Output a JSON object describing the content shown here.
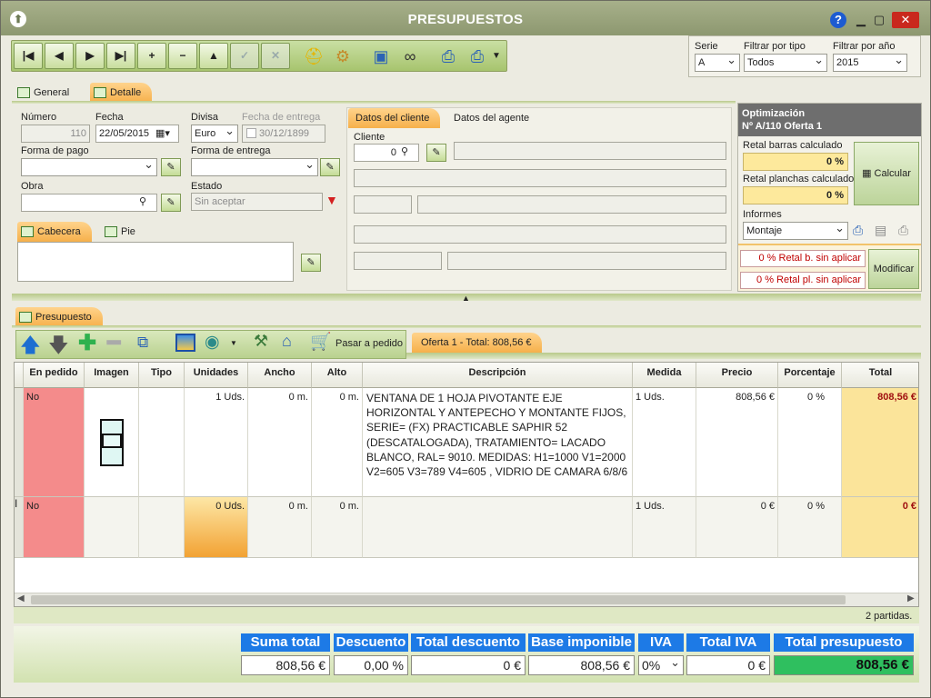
{
  "window": {
    "title": "PRESUPUESTOS",
    "help": "?",
    "minimize": "▁",
    "maximize": "▢",
    "close": "✕"
  },
  "toolbar": {
    "first": "|◀",
    "prev": "◀",
    "next": "▶",
    "last": "▶|",
    "add": "+",
    "remove": "−",
    "up": "▲",
    "confirm": "✓",
    "cancel": "✕"
  },
  "filters": {
    "serie_label": "Serie",
    "serie_value": "A",
    "tipo_label": "Filtrar por tipo",
    "tipo_value": "Todos",
    "anio_label": "Filtrar por año",
    "anio_value": "2015"
  },
  "tabs": {
    "general": "General",
    "detalle": "Detalle"
  },
  "detail": {
    "numero_label": "Número",
    "numero_value": "110",
    "fecha_label": "Fecha",
    "fecha_value": "22/05/2015",
    "divisa_label": "Divisa",
    "divisa_value": "Euro",
    "fecha_entrega_label": "Fecha de entrega",
    "fecha_entrega_value": "30/12/1899",
    "forma_pago_label": "Forma de pago",
    "forma_pago_value": "",
    "forma_entrega_label": "Forma de entrega",
    "forma_entrega_value": "",
    "obra_label": "Obra",
    "obra_value": "",
    "estado_label": "Estado",
    "estado_value": "Sin aceptar"
  },
  "subtabs": {
    "cabecera": "Cabecera",
    "pie": "Pie"
  },
  "client_tabs": {
    "cliente": "Datos del cliente",
    "agente": "Datos del agente"
  },
  "client": {
    "cliente_label": "Cliente",
    "cliente_value": "0"
  },
  "optim": {
    "title": "Optimización",
    "subtitle": "Nº A/110 Oferta 1",
    "barras_label": "Retal barras calculado",
    "barras_value": "0 %",
    "planchas_label": "Retal planchas calculado",
    "planchas_value": "0 %",
    "calcular": "Calcular",
    "informes_label": "Informes",
    "informes_value": "Montaje",
    "retal_b": "0 % Retal b. sin aplicar",
    "retal_pl": "0 % Retal pl. sin aplicar",
    "modificar": "Modificar"
  },
  "presupuesto_tab": "Presupuesto",
  "pasar_pedido": "Pasar a pedido",
  "oferta_tab": "Oferta 1 - Total: 808,56 €",
  "columns": [
    "En pedido",
    "Imagen",
    "Tipo",
    "Unidades",
    "Ancho",
    "Alto",
    "Descripción",
    "Medida",
    "Precio",
    "Porcentaje",
    "Total"
  ],
  "rows": [
    {
      "en_pedido": "No",
      "unidades": "1 Uds.",
      "ancho": "0 m.",
      "alto": "0 m.",
      "descripcion": "VENTANA DE 1 HOJA PIVOTANTE EJE HORIZONTAL Y ANTEPECHO Y MONTANTE FIJOS, SERIE= (FX) PRACTICABLE SAPHIR 52 (DESCATALOGADA), TRATAMIENTO= LACADO BLANCO, RAL= 9010. MEDIDAS: H1=1000 V1=2000 V2=605 V3=789 V4=605 , VIDRIO DE CAMARA 6/8/6",
      "medida": "1 Uds.",
      "precio": "808,56 €",
      "porcentaje": "0 %",
      "total": "808,56 €"
    },
    {
      "en_pedido": "No",
      "unidades": "0 Uds.",
      "ancho": "0 m.",
      "alto": "0 m.",
      "descripcion": "",
      "medida": "1 Uds.",
      "precio": "0 €",
      "porcentaje": "0 %",
      "total": "0 €"
    }
  ],
  "partidas": "2 partidas.",
  "totals": {
    "suma_total_label": "Suma total",
    "suma_total": "808,56 €",
    "descuento_label": "Descuento",
    "descuento": "0,00 %",
    "total_descuento_label": "Total descuento",
    "total_descuento": "0 €",
    "base_label": "Base imponible",
    "base": "808,56 €",
    "iva_label": "IVA",
    "iva": "0%",
    "total_iva_label": "Total IVA",
    "total_iva": "0 €",
    "total_presupuesto_label": "Total presupuesto",
    "total_presupuesto": "808,56 €"
  },
  "colors": {
    "accent_orange": "#f6b04b",
    "total_green": "#2fbf5f",
    "sum_header_blue": "#1d7ae6",
    "row_pink": "#f48b8b"
  }
}
